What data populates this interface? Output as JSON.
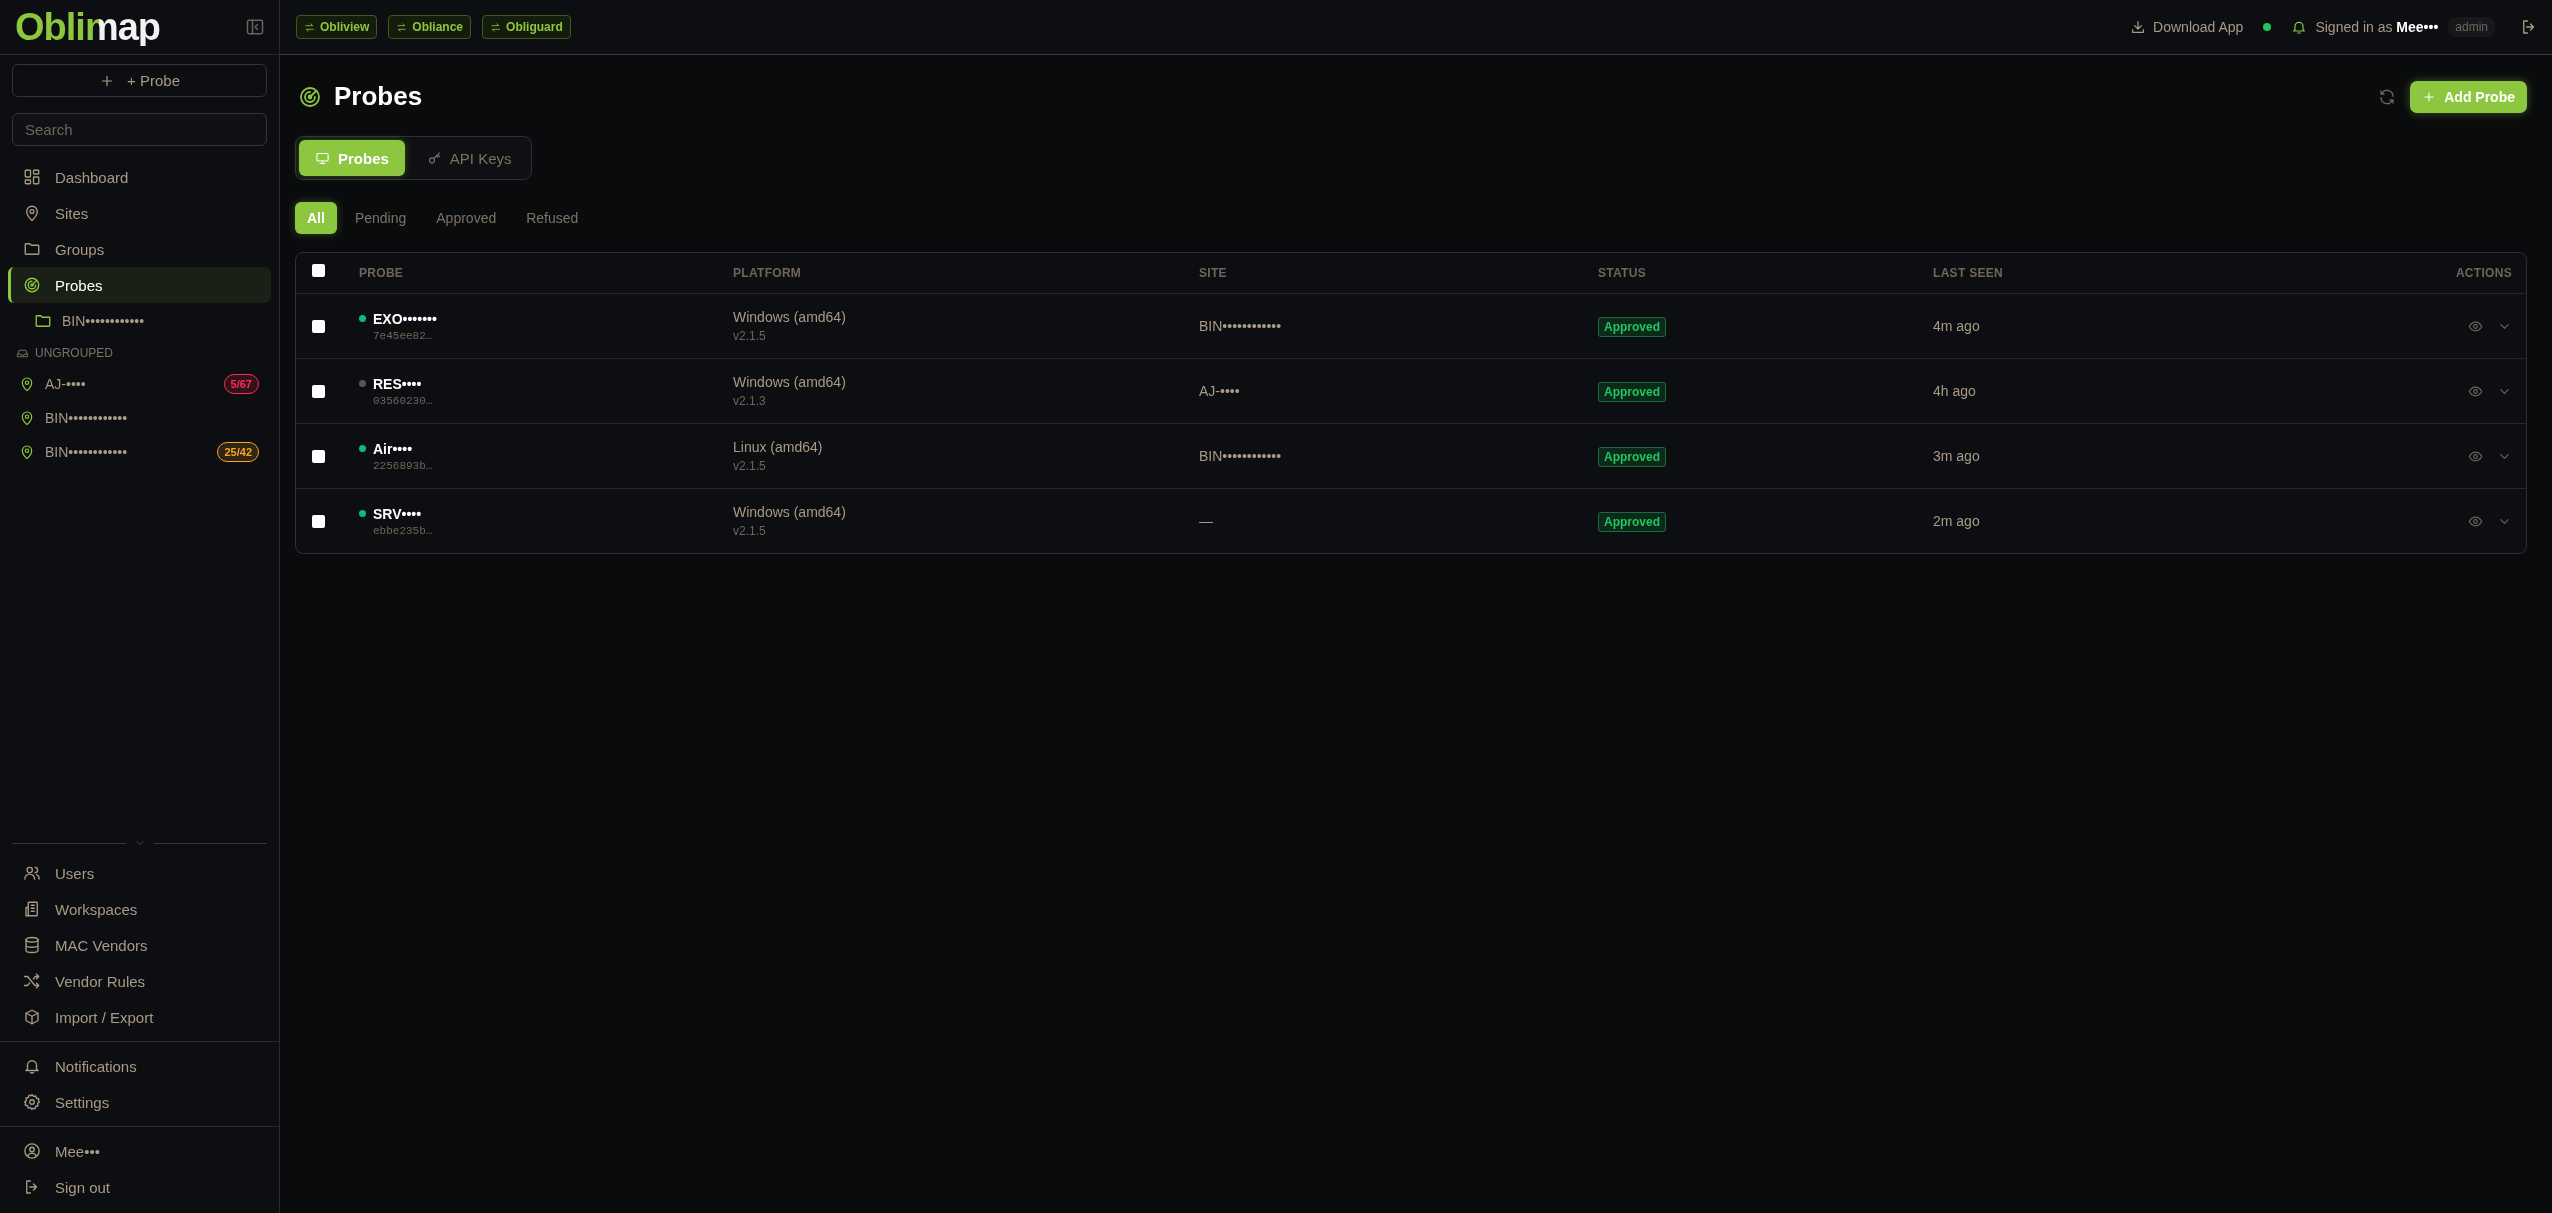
{
  "sidebar": {
    "logo": "Oblimap",
    "add_button": "+ Probe",
    "search": {
      "placeholder": "Search"
    },
    "nav": [
      {
        "label": "Dashboard",
        "selected": false
      },
      {
        "label": "Sites",
        "selected": false
      },
      {
        "label": "Groups",
        "selected": false
      },
      {
        "label": "Probes",
        "selected": true
      }
    ],
    "groups": [
      {
        "label": "BIN••••••••••••"
      }
    ],
    "ungrouped_label": "UNGROUPED",
    "sites": [
      {
        "label": "AJ-••••",
        "badge": "5/67",
        "color": "#ff2d55"
      },
      {
        "label": "BIN••••••••••••"
      },
      {
        "label": "BIN••••••••••••",
        "badge": "25/42",
        "color": "#f5a623"
      }
    ],
    "admin_nav": [
      {
        "label": "Users"
      },
      {
        "label": "Workspaces"
      },
      {
        "label": "MAC Vendors"
      },
      {
        "label": "Vendor Rules"
      },
      {
        "label": "Import / Export"
      }
    ],
    "footer_nav": [
      {
        "label": "Notifications"
      },
      {
        "label": "Settings"
      }
    ],
    "account_nav": [
      {
        "label": "Mee•••"
      },
      {
        "label": "Sign out"
      }
    ]
  },
  "topbar": {
    "app_links": [
      "Obliview",
      "Obliance",
      "Obliguard"
    ],
    "download": "Download App",
    "connected": true,
    "signed_in": "Signed in as **Mee•••**",
    "role": "admin"
  },
  "page": {
    "title": "Probes",
    "add_button": "Add Probe",
    "view_tabs": [
      {
        "label": "Probes",
        "selected": true
      },
      {
        "label": "API Keys",
        "selected": false
      }
    ],
    "filters": [
      {
        "label": "All",
        "selected": true
      },
      {
        "label": "Pending",
        "selected": false
      },
      {
        "label": "Approved",
        "selected": false
      },
      {
        "label": "Refused",
        "selected": false
      }
    ],
    "table": {
      "columns": [
        "PROBE",
        "PLATFORM",
        "SITE",
        "STATUS",
        "LAST SEEN",
        "ACTIONS"
      ],
      "all_checked": false,
      "rows": [
        {
          "checked": false,
          "online": true,
          "name": "EXO•••••••",
          "id": "7e45ee82…",
          "platform": "Windows (amd64)",
          "version": "v2.1.5",
          "site": "BIN••••••••••••",
          "status": "Approved",
          "last_seen": "4m ago"
        },
        {
          "checked": false,
          "online": false,
          "name": "RES••••",
          "id": "03560230…",
          "platform": "Windows (amd64)",
          "version": "v2.1.3",
          "site": "AJ-••••",
          "status": "Approved",
          "last_seen": "4h ago"
        },
        {
          "checked": false,
          "online": true,
          "name": "Air••••",
          "id": "2256893b…",
          "platform": "Linux (amd64)",
          "version": "v2.1.5",
          "site": "BIN••••••••••••",
          "status": "Approved",
          "last_seen": "3m ago"
        },
        {
          "checked": false,
          "online": true,
          "name": "SRV••••",
          "id": "ebbe235b…",
          "platform": "Windows (amd64)",
          "version": "v2.1.5",
          "site": "—",
          "status": "Approved",
          "last_seen": "2m ago"
        }
      ]
    }
  }
}
